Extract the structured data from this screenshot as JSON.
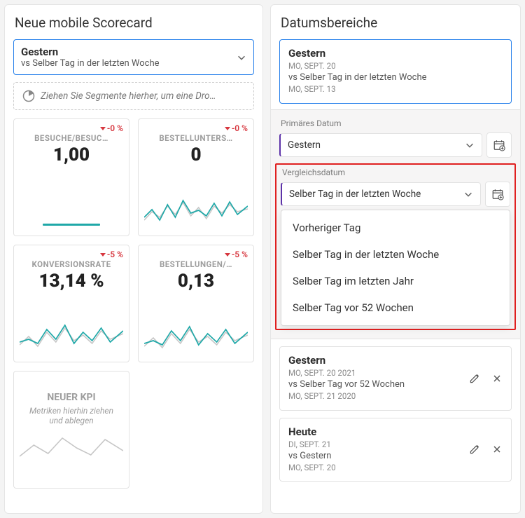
{
  "left": {
    "title": "Neue mobile Scorecard",
    "date_selector": {
      "line1": "Gestern",
      "line2": "vs Selber Tag in der letzten Woche"
    },
    "drop_hint": "Ziehen Sie Segmente hierher, um eine Dro…",
    "cards": [
      {
        "delta": "-0 %",
        "label": "BESUCHE/BESUC…",
        "value": "1,00",
        "kind": "bar"
      },
      {
        "delta": "-0 %",
        "label": "BESTELLUNTERS…",
        "value": "0",
        "kind": "spark"
      },
      {
        "delta": "-5 %",
        "label": "KONVERSIONSRATE",
        "value": "13,14 %",
        "kind": "spark"
      },
      {
        "delta": "-5 %",
        "label": "BESTELLUNGEN/…",
        "value": "0,13",
        "kind": "spark"
      }
    ],
    "empty_card": {
      "title": "NEUER KPI",
      "hint": "Metriken hierhin ziehen und ablegen"
    }
  },
  "right": {
    "title": "Datumsbereiche",
    "active": {
      "title": "Gestern",
      "date1": "MO, SEPT. 20",
      "compare": "vs Selber Tag in der letzten Woche",
      "date2": "MO, SEPT. 13"
    },
    "primary_label": "Primäres Datum",
    "primary_value": "Gestern",
    "compare_label": "Vergleichsdatum",
    "compare_value": "Selber Tag in der letzten Woche",
    "options": [
      "Vorheriger Tag",
      "Selber Tag in der letzten Woche",
      "Selber Tag im letzten Jahr",
      "Selber Tag vor 52 Wochen"
    ],
    "cards": [
      {
        "title": "Gestern",
        "d1": "MO, SEPT. 20 2021",
        "cmp": "vs Selber Tag vor 52 Wochen",
        "d2": "MO, SEPT. 21 2020"
      },
      {
        "title": "Heute",
        "d1": "DI, SEPT. 21",
        "cmp": "vs Gestern",
        "d2": "MO, SEPT. 20"
      }
    ]
  }
}
